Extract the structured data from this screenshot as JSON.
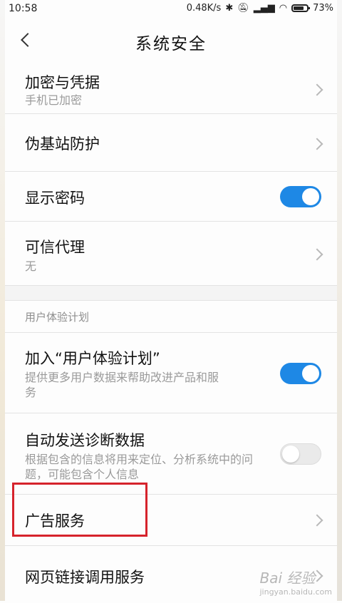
{
  "status_bar": {
    "time": "10:58",
    "speed": "0.48K/s",
    "battery": "73%",
    "icons": [
      "bluetooth-icon",
      "mute-icon",
      "signal-icon",
      "wifi-icon",
      "battery-icon"
    ]
  },
  "header": {
    "title": "系统安全"
  },
  "settings": {
    "encryption": {
      "label": "加密与凭据",
      "sub": "手机已加密"
    },
    "fake_base_station": {
      "label": "伪基站防护"
    },
    "show_password": {
      "label": "显示密码",
      "toggle": "on"
    },
    "trust_agent": {
      "label": "可信代理",
      "sub": "无"
    },
    "section_user_experience": "用户体验计划",
    "join_plan": {
      "label": "加入“用户体验计划”",
      "sub": "提供更多用户数据来帮助改进产品和服务",
      "toggle": "on"
    },
    "auto_diagnostics": {
      "label": "自动发送诊断数据",
      "sub": "根据包含的信息将用来定位、分析系统中的问题，可能包含个人信息",
      "toggle": "off"
    },
    "ad_service": {
      "label": "广告服务"
    },
    "web_link_service": {
      "label": "网页链接调用服务"
    }
  },
  "watermark": {
    "text": "Bai 经验",
    "sub": "jingyan.baidu.com"
  },
  "colors": {
    "accent": "#1e88e5",
    "highlight": "#d6232c"
  }
}
